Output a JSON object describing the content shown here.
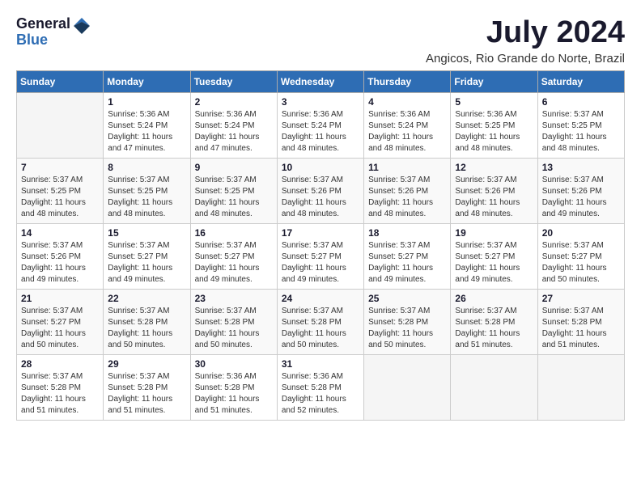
{
  "logo": {
    "general": "General",
    "blue": "Blue"
  },
  "title": {
    "month": "July 2024",
    "location": "Angicos, Rio Grande do Norte, Brazil"
  },
  "headers": [
    "Sunday",
    "Monday",
    "Tuesday",
    "Wednesday",
    "Thursday",
    "Friday",
    "Saturday"
  ],
  "weeks": [
    [
      {
        "day": "",
        "info": ""
      },
      {
        "day": "1",
        "info": "Sunrise: 5:36 AM\nSunset: 5:24 PM\nDaylight: 11 hours\nand 47 minutes."
      },
      {
        "day": "2",
        "info": "Sunrise: 5:36 AM\nSunset: 5:24 PM\nDaylight: 11 hours\nand 47 minutes."
      },
      {
        "day": "3",
        "info": "Sunrise: 5:36 AM\nSunset: 5:24 PM\nDaylight: 11 hours\nand 48 minutes."
      },
      {
        "day": "4",
        "info": "Sunrise: 5:36 AM\nSunset: 5:24 PM\nDaylight: 11 hours\nand 48 minutes."
      },
      {
        "day": "5",
        "info": "Sunrise: 5:36 AM\nSunset: 5:25 PM\nDaylight: 11 hours\nand 48 minutes."
      },
      {
        "day": "6",
        "info": "Sunrise: 5:37 AM\nSunset: 5:25 PM\nDaylight: 11 hours\nand 48 minutes."
      }
    ],
    [
      {
        "day": "7",
        "info": "Sunrise: 5:37 AM\nSunset: 5:25 PM\nDaylight: 11 hours\nand 48 minutes."
      },
      {
        "day": "8",
        "info": "Sunrise: 5:37 AM\nSunset: 5:25 PM\nDaylight: 11 hours\nand 48 minutes."
      },
      {
        "day": "9",
        "info": "Sunrise: 5:37 AM\nSunset: 5:25 PM\nDaylight: 11 hours\nand 48 minutes."
      },
      {
        "day": "10",
        "info": "Sunrise: 5:37 AM\nSunset: 5:26 PM\nDaylight: 11 hours\nand 48 minutes."
      },
      {
        "day": "11",
        "info": "Sunrise: 5:37 AM\nSunset: 5:26 PM\nDaylight: 11 hours\nand 48 minutes."
      },
      {
        "day": "12",
        "info": "Sunrise: 5:37 AM\nSunset: 5:26 PM\nDaylight: 11 hours\nand 48 minutes."
      },
      {
        "day": "13",
        "info": "Sunrise: 5:37 AM\nSunset: 5:26 PM\nDaylight: 11 hours\nand 49 minutes."
      }
    ],
    [
      {
        "day": "14",
        "info": "Sunrise: 5:37 AM\nSunset: 5:26 PM\nDaylight: 11 hours\nand 49 minutes."
      },
      {
        "day": "15",
        "info": "Sunrise: 5:37 AM\nSunset: 5:27 PM\nDaylight: 11 hours\nand 49 minutes."
      },
      {
        "day": "16",
        "info": "Sunrise: 5:37 AM\nSunset: 5:27 PM\nDaylight: 11 hours\nand 49 minutes."
      },
      {
        "day": "17",
        "info": "Sunrise: 5:37 AM\nSunset: 5:27 PM\nDaylight: 11 hours\nand 49 minutes."
      },
      {
        "day": "18",
        "info": "Sunrise: 5:37 AM\nSunset: 5:27 PM\nDaylight: 11 hours\nand 49 minutes."
      },
      {
        "day": "19",
        "info": "Sunrise: 5:37 AM\nSunset: 5:27 PM\nDaylight: 11 hours\nand 49 minutes."
      },
      {
        "day": "20",
        "info": "Sunrise: 5:37 AM\nSunset: 5:27 PM\nDaylight: 11 hours\nand 50 minutes."
      }
    ],
    [
      {
        "day": "21",
        "info": "Sunrise: 5:37 AM\nSunset: 5:27 PM\nDaylight: 11 hours\nand 50 minutes."
      },
      {
        "day": "22",
        "info": "Sunrise: 5:37 AM\nSunset: 5:28 PM\nDaylight: 11 hours\nand 50 minutes."
      },
      {
        "day": "23",
        "info": "Sunrise: 5:37 AM\nSunset: 5:28 PM\nDaylight: 11 hours\nand 50 minutes."
      },
      {
        "day": "24",
        "info": "Sunrise: 5:37 AM\nSunset: 5:28 PM\nDaylight: 11 hours\nand 50 minutes."
      },
      {
        "day": "25",
        "info": "Sunrise: 5:37 AM\nSunset: 5:28 PM\nDaylight: 11 hours\nand 50 minutes."
      },
      {
        "day": "26",
        "info": "Sunrise: 5:37 AM\nSunset: 5:28 PM\nDaylight: 11 hours\nand 51 minutes."
      },
      {
        "day": "27",
        "info": "Sunrise: 5:37 AM\nSunset: 5:28 PM\nDaylight: 11 hours\nand 51 minutes."
      }
    ],
    [
      {
        "day": "28",
        "info": "Sunrise: 5:37 AM\nSunset: 5:28 PM\nDaylight: 11 hours\nand 51 minutes."
      },
      {
        "day": "29",
        "info": "Sunrise: 5:37 AM\nSunset: 5:28 PM\nDaylight: 11 hours\nand 51 minutes."
      },
      {
        "day": "30",
        "info": "Sunrise: 5:36 AM\nSunset: 5:28 PM\nDaylight: 11 hours\nand 51 minutes."
      },
      {
        "day": "31",
        "info": "Sunrise: 5:36 AM\nSunset: 5:28 PM\nDaylight: 11 hours\nand 52 minutes."
      },
      {
        "day": "",
        "info": ""
      },
      {
        "day": "",
        "info": ""
      },
      {
        "day": "",
        "info": ""
      }
    ]
  ]
}
